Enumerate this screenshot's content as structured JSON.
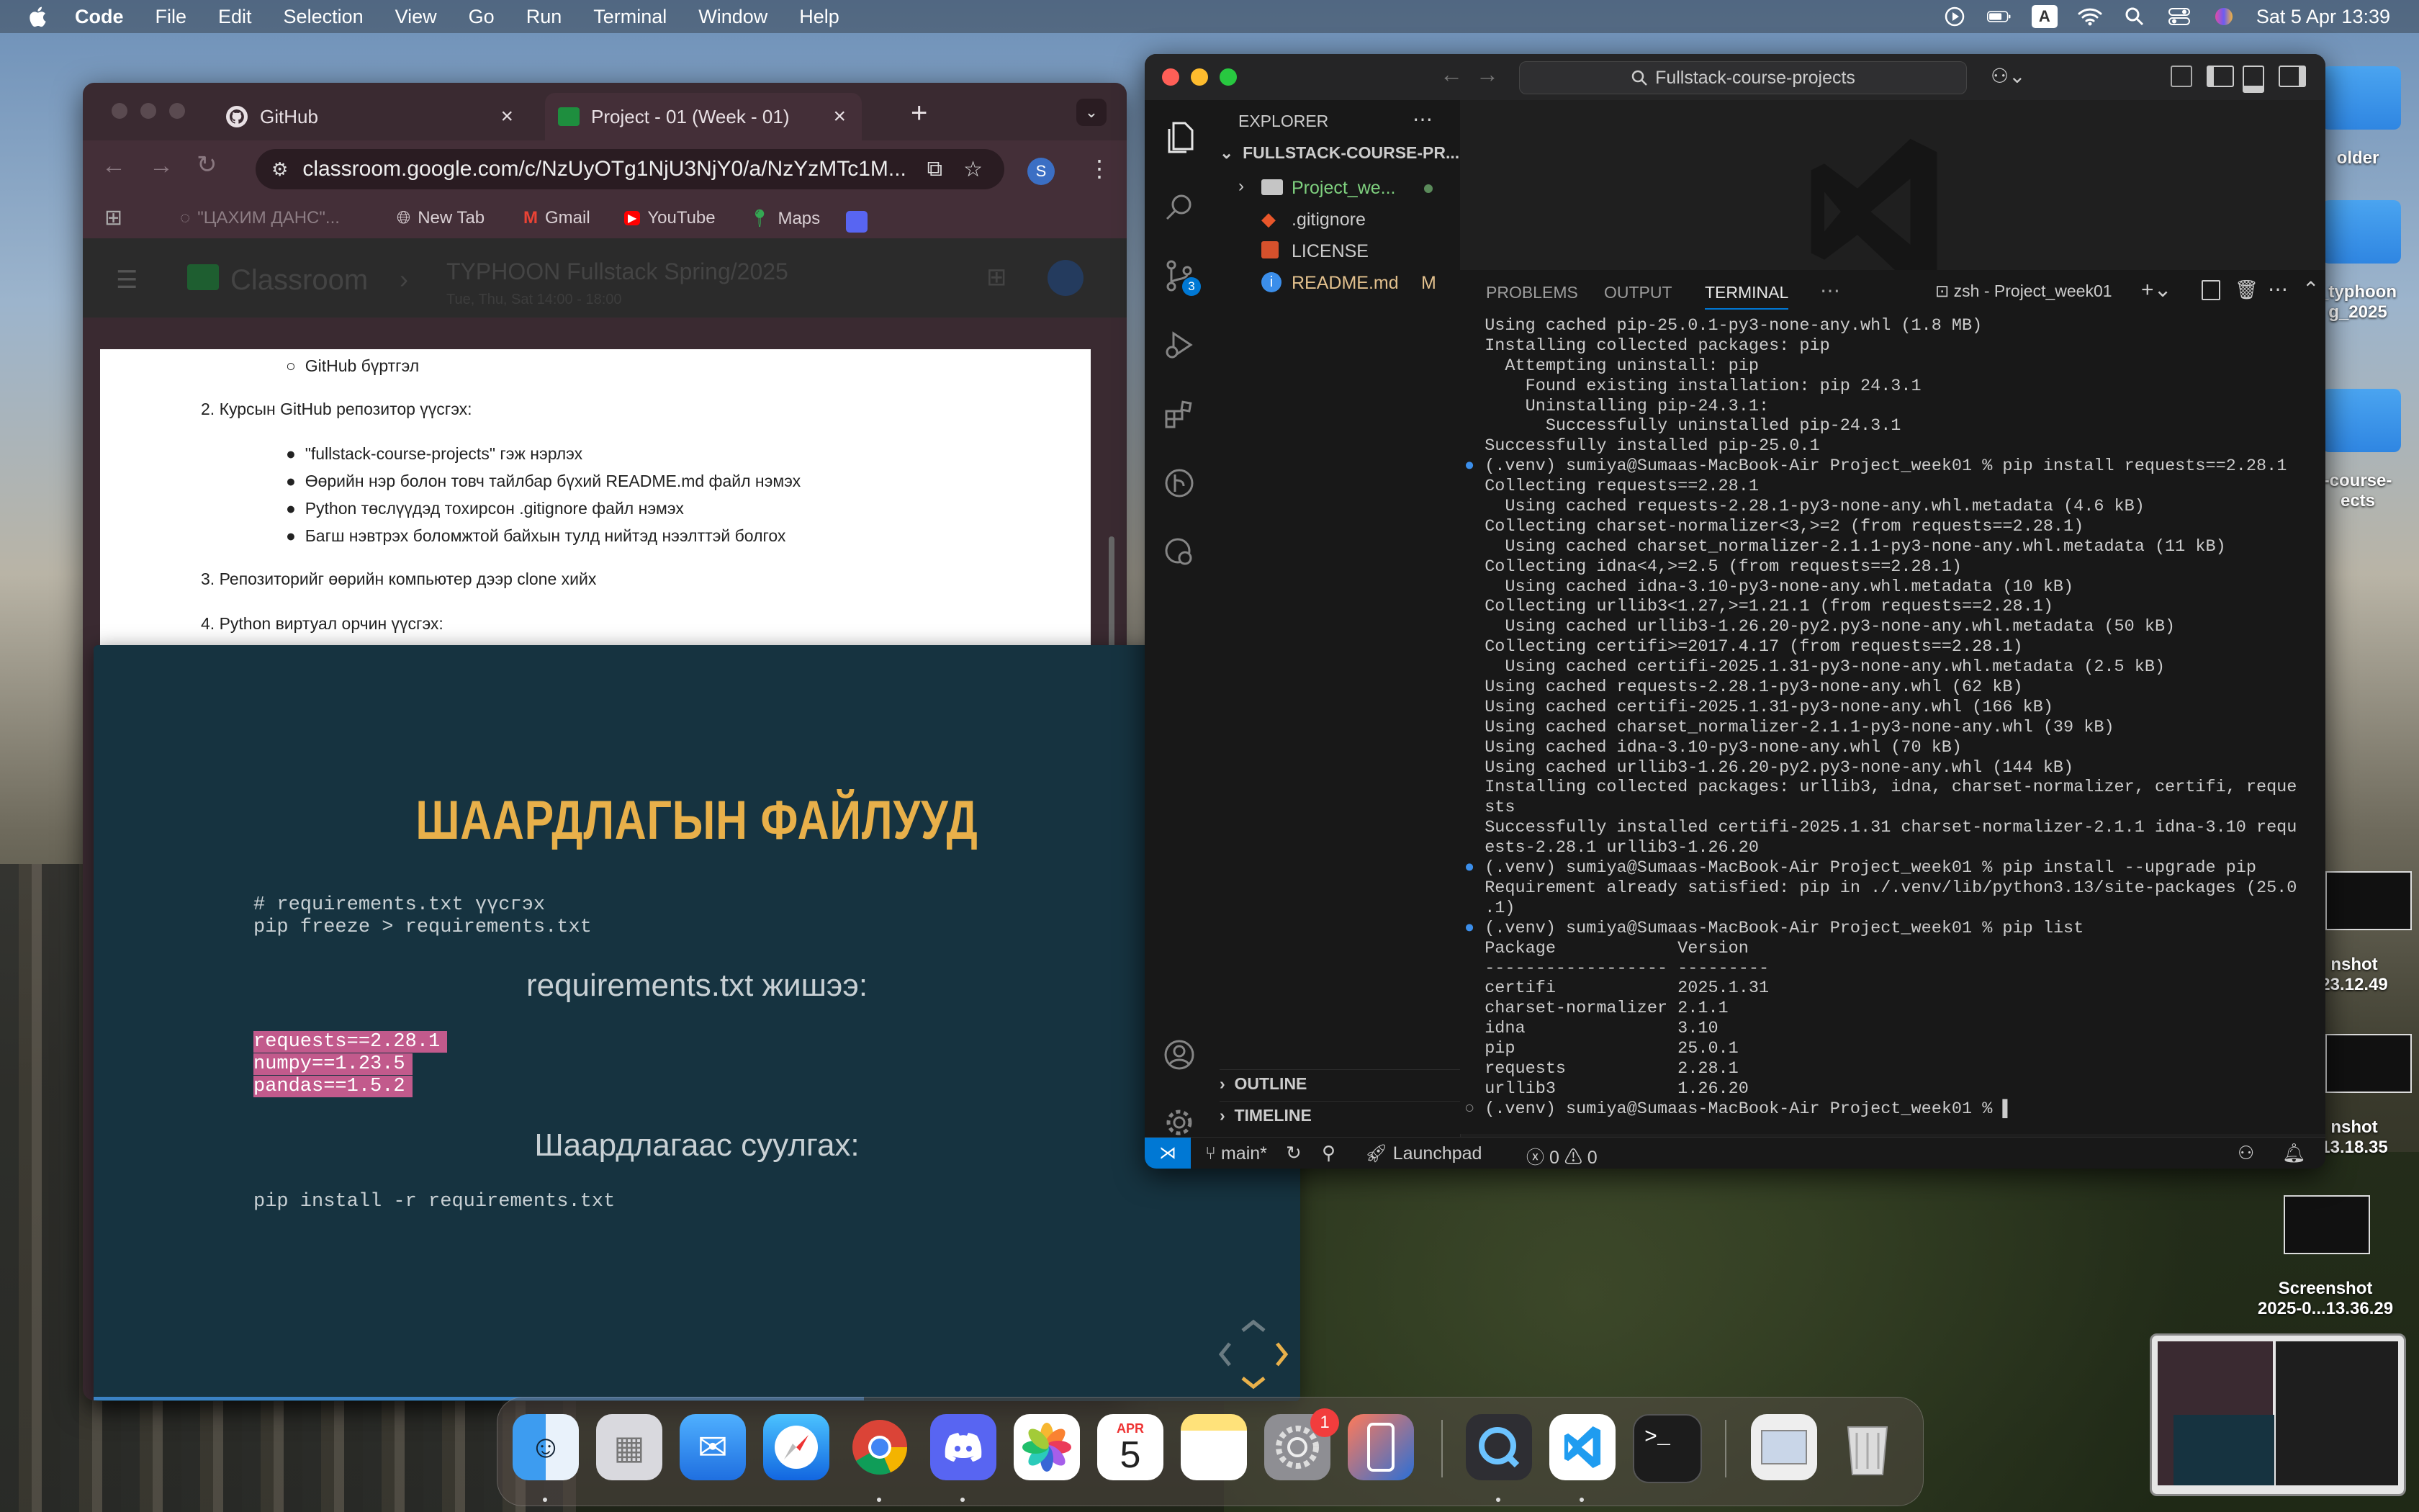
{
  "menubar": {
    "app_name": "Code",
    "menus": [
      "File",
      "Edit",
      "Selection",
      "View",
      "Go",
      "Run",
      "Terminal",
      "Window",
      "Help"
    ],
    "input_badge": "A",
    "datetime": "Sat 5 Apr  13:39"
  },
  "desktop": {
    "items": [
      {
        "label": "older"
      },
      {
        "label": "_typhoon\ng_2025"
      },
      {
        "label": "-course-\nects"
      },
      {
        "label": "nshot\n23.12.49"
      },
      {
        "label": "nshot\n13.18.35"
      },
      {
        "label": "Screenshot\n2025-0...13.36.29"
      }
    ]
  },
  "chrome": {
    "tabs": [
      {
        "label": "GitHub",
        "icon": "github-icon"
      },
      {
        "label": "Project - 01 (Week - 01)",
        "icon": "classroom-icon"
      }
    ],
    "url": "classroom.google.com/c/NzUyOTg1NjU3NjY0/a/NzYzMTc1M...",
    "profile_initial": "S",
    "bookmarks": [
      "\"ЦАХИМ ДАНС\"...",
      "New Tab",
      "Gmail",
      "YouTube",
      "Maps"
    ],
    "page_header": {
      "app": "Classroom",
      "course": "TYPHOON Fullstack Spring/2025",
      "schedule": "Tue, Thu, Sat 14:00 - 18:00"
    },
    "doc": {
      "bullet0": "GitHub бүртгэл",
      "step2": "2. Курсын GitHub репозитор үүсгэх:",
      "step2_bullets": [
        "\"fullstack-course-projects\" гэж нэрлэх",
        "Өөрийн нэр болон товч тайлбар бүхий README.md файл нэмэх",
        "Python төслүүдэд тохирсон .gitignore файл нэмэх",
        "Багш нэвтрэх боломжтой байхын тулд нийтэд нээлттэй болгох"
      ],
      "step3": "3. Репозиторийг өөрийн компьютер дээр clone хийх",
      "step4": "4. Python виртуал орчин үүсгэх:"
    }
  },
  "slide": {
    "title": "ШААРДЛАГЫН ФАЙЛУУД",
    "code1": [
      "# requirements.txt үүсгэх",
      "pip freeze > requirements.txt"
    ],
    "subtitle1": "requirements.txt жишээ:",
    "highlight_lines": [
      "requests==2.28.1",
      "numpy==1.23.5",
      "pandas==1.5.2"
    ],
    "subtitle2": "Шаардлагаас суулгах:",
    "code2": "pip install -r requirements.txt"
  },
  "vscode": {
    "search": "Fullstack-course-projects",
    "explorer": {
      "title": "EXPLORER",
      "root": "FULLSTACK-COURSE-PR...",
      "items": [
        {
          "label": "Project_we...",
          "icon": "folder-icon"
        },
        {
          "label": ".gitignore",
          "icon": "git-icon"
        },
        {
          "label": "LICENSE",
          "icon": "license-icon"
        },
        {
          "label": "README.md",
          "icon": "info-icon",
          "badge": "M"
        }
      ],
      "outline": "OUTLINE",
      "timeline": "TIMELINE"
    },
    "scm_badge": "3",
    "panel": {
      "tabs": [
        "PROBLEMS",
        "OUTPUT",
        "TERMINAL"
      ],
      "active_tab": "TERMINAL",
      "shell": "zsh - Project_week01"
    },
    "terminal_lines": [
      "  Using cached pip-25.0.1-py3-none-any.whl (1.8 MB)",
      "  Installing collected packages: pip",
      "    Attempting uninstall: pip",
      "      Found existing installation: pip 24.3.1",
      "      Uninstalling pip-24.3.1:",
      "        Successfully uninstalled pip-24.3.1",
      "  Successfully installed pip-25.0.1",
      "● (.venv) sumiya@Sumaas-MacBook-Air Project_week01 % pip install requests==2.28.1",
      "  Collecting requests==2.28.1",
      "    Using cached requests-2.28.1-py3-none-any.whl.metadata (4.6 kB)",
      "  Collecting charset-normalizer<3,>=2 (from requests==2.28.1)",
      "    Using cached charset_normalizer-2.1.1-py3-none-any.whl.metadata (11 kB)",
      "  Collecting idna<4,>=2.5 (from requests==2.28.1)",
      "    Using cached idna-3.10-py3-none-any.whl.metadata (10 kB)",
      "  Collecting urllib3<1.27,>=1.21.1 (from requests==2.28.1)",
      "    Using cached urllib3-1.26.20-py2.py3-none-any.whl.metadata (50 kB)",
      "  Collecting certifi>=2017.4.17 (from requests==2.28.1)",
      "    Using cached certifi-2025.1.31-py3-none-any.whl.metadata (2.5 kB)",
      "  Using cached requests-2.28.1-py3-none-any.whl (62 kB)",
      "  Using cached certifi-2025.1.31-py3-none-any.whl (166 kB)",
      "  Using cached charset_normalizer-2.1.1-py3-none-any.whl (39 kB)",
      "  Using cached idna-3.10-py3-none-any.whl (70 kB)",
      "  Using cached urllib3-1.26.20-py2.py3-none-any.whl (144 kB)",
      "  Installing collected packages: urllib3, idna, charset-normalizer, certifi, reque",
      "  sts",
      "  Successfully installed certifi-2025.1.31 charset-normalizer-2.1.1 idna-3.10 requ",
      "  ests-2.28.1 urllib3-1.26.20",
      "● (.venv) sumiya@Sumaas-MacBook-Air Project_week01 % pip install --upgrade pip",
      "  Requirement already satisfied: pip in ./.venv/lib/python3.13/site-packages (25.0",
      "  .1)",
      "● (.venv) sumiya@Sumaas-MacBook-Air Project_week01 % pip list",
      "  Package            Version",
      "  ------------------ ---------",
      "  certifi            2025.1.31",
      "  charset-normalizer 2.1.1",
      "  idna               3.10",
      "  pip                25.0.1",
      "  requests           2.28.1",
      "  urllib3            1.26.20",
      "○ (.venv) sumiya@Sumaas-MacBook-Air Project_week01 % ▌"
    ],
    "status": {
      "branch": "main*",
      "launchpad": "Launchpad",
      "errors": "0",
      "warnings": "0"
    }
  },
  "dock": {
    "apps": [
      "finder-icon",
      "launchpad-icon",
      "mail-icon",
      "safari-icon",
      "chrome-icon",
      "discord-icon",
      "photos-icon",
      "calendar-icon",
      "notes-icon",
      "settings-icon",
      "iphone-mirroring-icon",
      "quicktime-icon",
      "vscode-icon",
      "terminal-icon",
      "preview-icon",
      "trash-icon"
    ],
    "calendar_month": "APR",
    "calendar_day": "5",
    "settings_badge": "1"
  },
  "colors": {
    "accent_blue": "#0078d4",
    "slide_title": "#e8b04a",
    "slide_bg": "#163340",
    "highlight": "#c25a8c"
  }
}
